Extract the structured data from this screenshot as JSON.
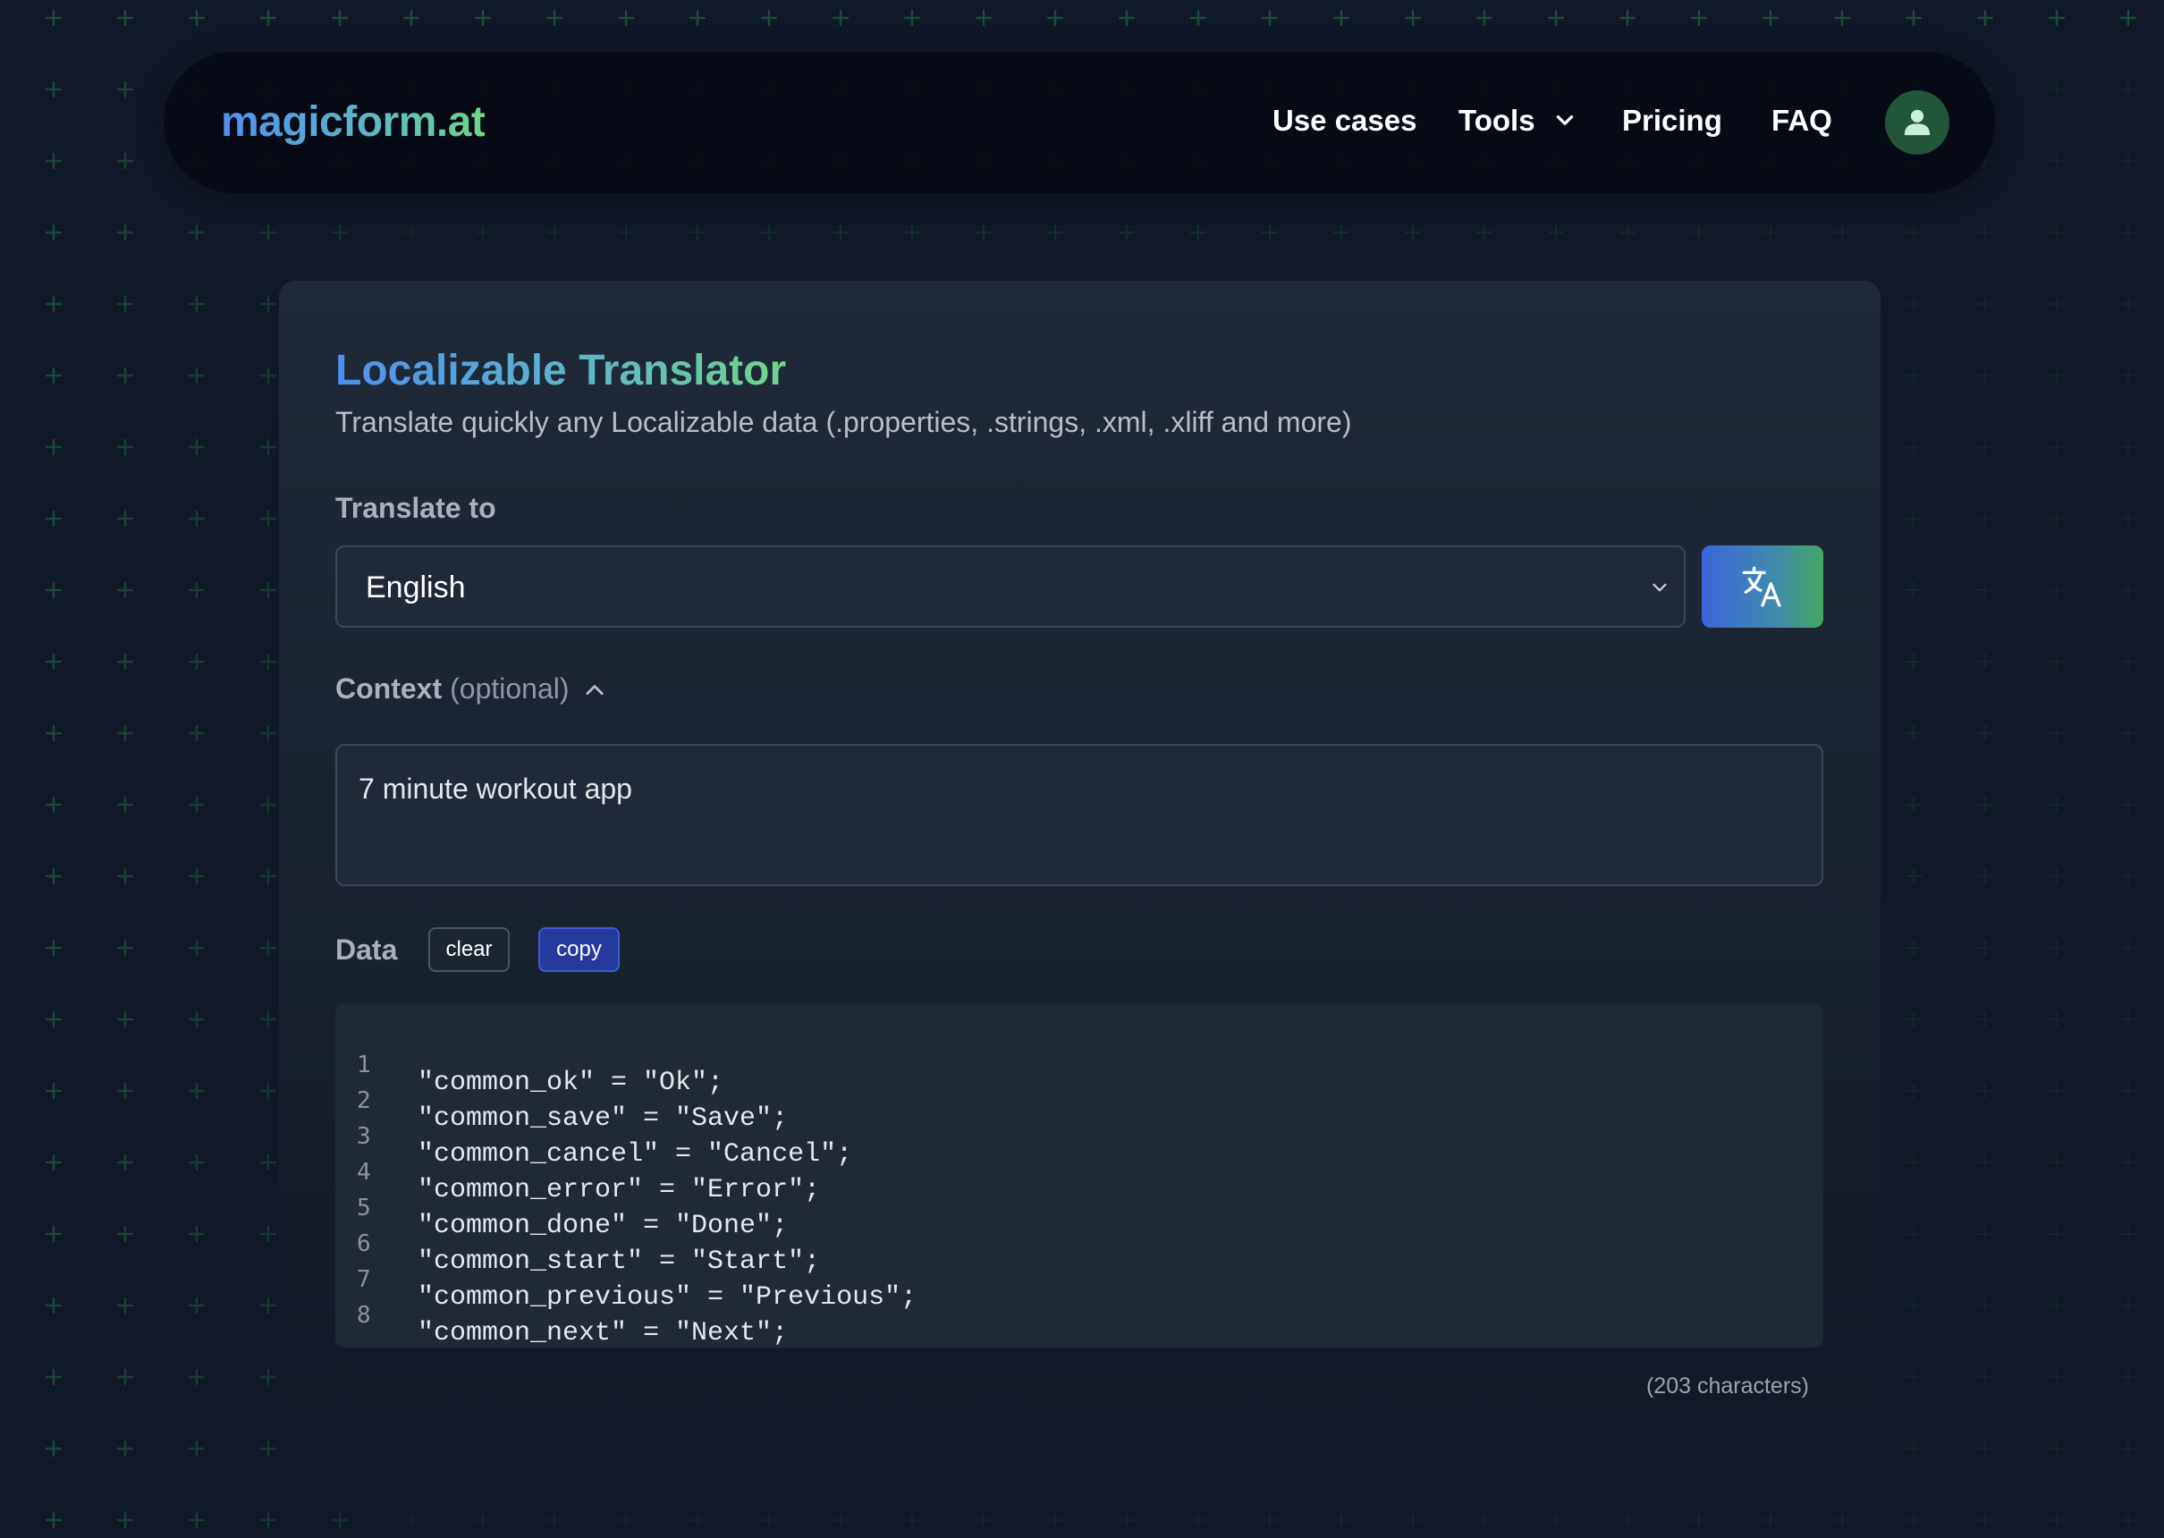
{
  "brand": {
    "name": "magicform.at"
  },
  "nav": {
    "use_cases": "Use cases",
    "tools": "Tools",
    "pricing": "Pricing",
    "faq": "FAQ"
  },
  "icons": {
    "avatar": "user-icon",
    "translate": "translate-icon",
    "tools_caret": "chevron-down-icon",
    "select_caret": "chevron-down-icon",
    "context_caret": "chevron-up-icon"
  },
  "colors": {
    "page_bg": "#111827",
    "card_bg": "#1f2937",
    "plus_grid": "#1f7a45",
    "avatar_bg": "#22563a",
    "copy_button": "#253a9a",
    "gradient_start": "#4f8ff0",
    "gradient_end": "#6fd68a"
  },
  "main": {
    "title": "Localizable Translator",
    "subtitle": "Translate quickly any Localizable data (.properties, .strings, .xml, .xliff and more)",
    "translate_to_label": "Translate to",
    "language": {
      "selected": "English"
    },
    "context": {
      "label": "Context",
      "optional": "(optional)",
      "value": "7 minute workout app"
    },
    "data": {
      "label": "Data",
      "clear_label": "clear",
      "copy_label": "copy",
      "lines": [
        {
          "num": "1",
          "text": "\"common_ok\" = \"Ok\";"
        },
        {
          "num": "2",
          "text": "\"common_save\" = \"Save\";"
        },
        {
          "num": "3",
          "text": "\"common_cancel\" = \"Cancel\";"
        },
        {
          "num": "4",
          "text": "\"common_error\" = \"Error\";"
        },
        {
          "num": "5",
          "text": "\"common_done\" = \"Done\";"
        },
        {
          "num": "6",
          "text": "\"common_start\" = \"Start\";"
        },
        {
          "num": "7",
          "text": "\"common_previous\" = \"Previous\";"
        },
        {
          "num": "8",
          "text": "\"common_next\" = \"Next\";"
        }
      ],
      "char_count": "(203 characters)"
    }
  }
}
